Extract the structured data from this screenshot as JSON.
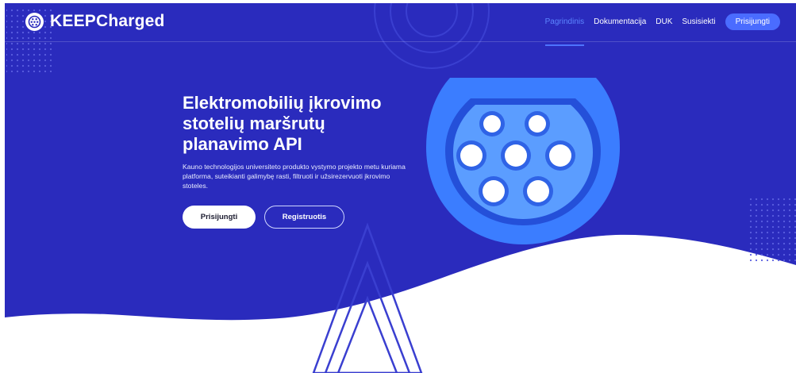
{
  "brand": {
    "name": "KEEPCharged",
    "logo_icon": "ev-connector-icon"
  },
  "nav": {
    "items": [
      {
        "label": "Pagrindinis",
        "active": true
      },
      {
        "label": "Dokumentacija",
        "active": false
      },
      {
        "label": "DUK",
        "active": false
      },
      {
        "label": "Susisiekti",
        "active": false
      }
    ],
    "login_button": "Prisijungti"
  },
  "hero": {
    "headline": "Elektromobilių įkrovimo stotelių maršrutų planavimo API",
    "description": "Kauno technologijos universiteto produkto vystymo projekto metu kuriama platforma, suteikianti galimybę rasti, filtruoti ir užsirezervuoti įkrovimo stoteles.",
    "primary_button": "Prisijungti",
    "secondary_button": "Registruotis"
  },
  "colors": {
    "hero_bg": "#2a2bbd",
    "accent": "#4a6cff",
    "active_nav": "#5d86ff",
    "connector_outer": "#3b7dff",
    "connector_inner": "#5b9dff"
  },
  "illustration": {
    "icon": "ev-plug-socket-icon"
  }
}
